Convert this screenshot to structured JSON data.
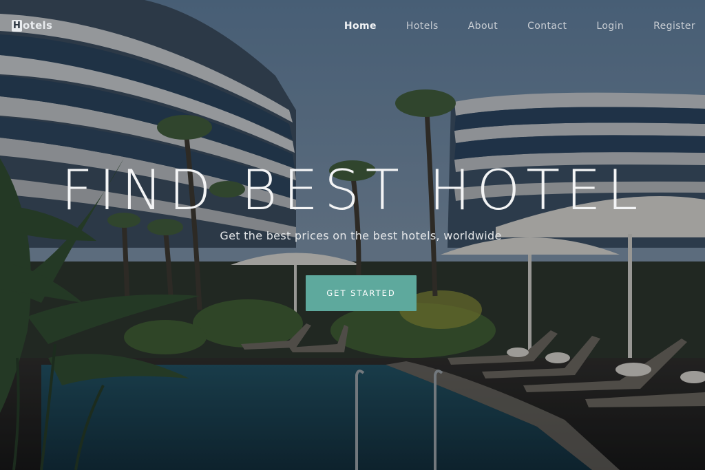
{
  "nav": {
    "logo_letter": "H",
    "logo_text": "otels",
    "links": [
      {
        "label": "Home",
        "active": true
      },
      {
        "label": "Hotels",
        "active": false
      },
      {
        "label": "About",
        "active": false
      },
      {
        "label": "Contact",
        "active": false
      },
      {
        "label": "Login",
        "active": false
      },
      {
        "label": "Register",
        "active": false
      }
    ]
  },
  "hero": {
    "headline": "FIND BEST HOTEL",
    "subtitle": "Get the best prices on the best hotels, worldwide",
    "cta_label": "GET STARTED",
    "background_image": "hotel-pool-photo"
  },
  "colors": {
    "accent": "#5ea99d",
    "text_light": "#f3f4f5",
    "nav_text": "#c9ced4"
  }
}
